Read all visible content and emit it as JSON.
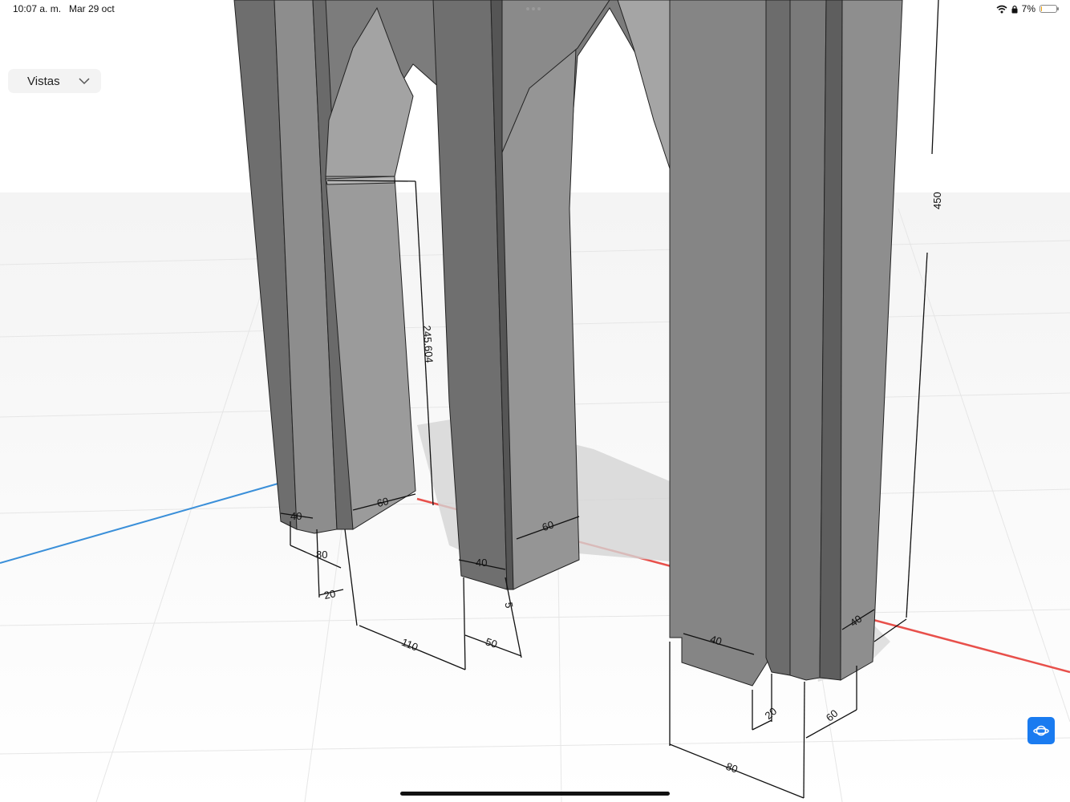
{
  "status_bar": {
    "time": "10:07 a. m.",
    "date": "Mar 29 oct",
    "battery_percent": "7%",
    "battery_level": 0.07,
    "icons": [
      "wifi-icon",
      "lock-icon",
      "battery-icon"
    ]
  },
  "views_menu": {
    "label": "Vistas",
    "icon": "chevron-down-icon"
  },
  "orbit_button": {
    "icon": "orbit-icon",
    "color": "#1a7bf0"
  },
  "axes": {
    "x_color": "#e8504b",
    "y_color": "#3a8fd9"
  },
  "model_color": "#8a8a8a",
  "dimensions": {
    "d40_a": "40",
    "d80_a": "80",
    "d20_a": "20",
    "d60_a": "60",
    "d245": "245.604",
    "d110": "110",
    "d40_b": "40",
    "d5": "5",
    "d50": "50",
    "d60_b": "60",
    "d450": "450",
    "d40_c": "40",
    "d40_d": "40",
    "d20_b": "20",
    "d60_c": "60",
    "d80_b": "80"
  }
}
